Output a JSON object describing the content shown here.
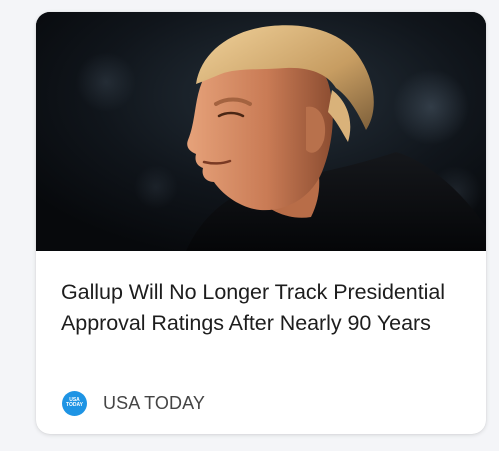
{
  "card": {
    "headline": "Gallup Will No Longer Track Presidential Approval Ratings After Nearly 90 Years",
    "image_subject": "photo of a man in a dark coat at night",
    "source": {
      "name": "USA TODAY",
      "logo_line1": "USA",
      "logo_line2": "TODAY",
      "logo_color": "#1e94e4"
    }
  }
}
